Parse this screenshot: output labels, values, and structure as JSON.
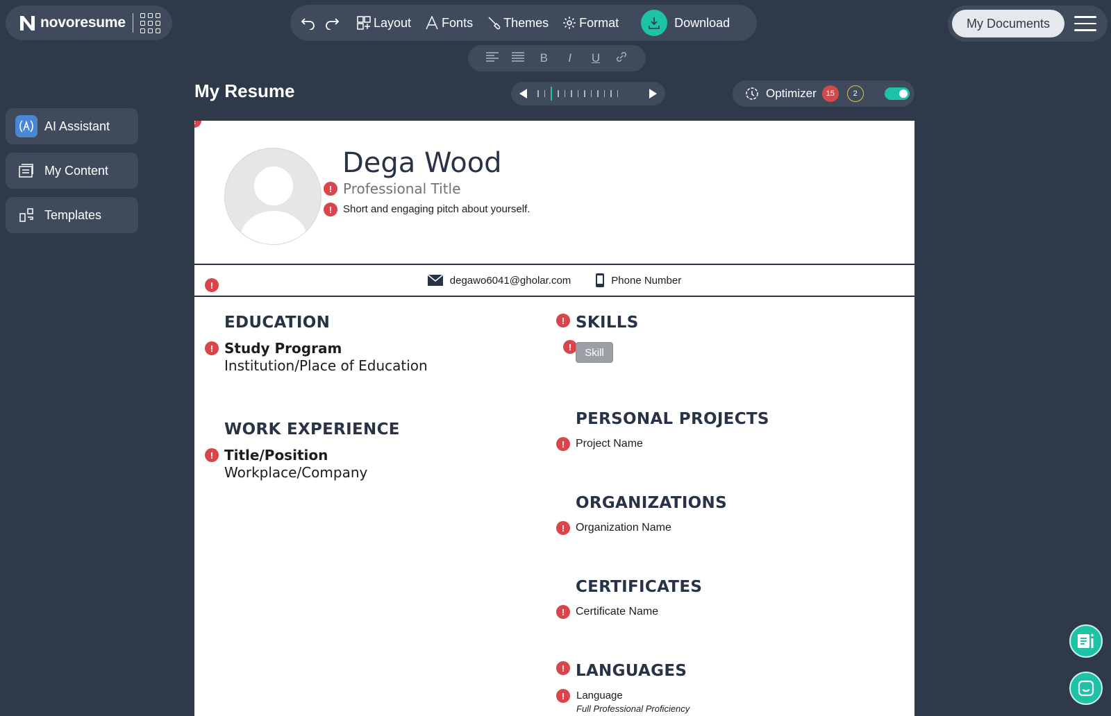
{
  "brand": {
    "name": "novoresume"
  },
  "toolbar": {
    "layout": "Layout",
    "fonts": "Fonts",
    "themes": "Themes",
    "format": "Format",
    "download": "Download"
  },
  "header_right": {
    "my_documents": "My Documents"
  },
  "sidebar": {
    "items": [
      {
        "label": "AI Assistant",
        "icon": "ai-assistant-icon"
      },
      {
        "label": "My Content",
        "icon": "my-content-icon"
      },
      {
        "label": "Templates",
        "icon": "templates-icon"
      }
    ]
  },
  "page": {
    "title": "My Resume"
  },
  "optimizer": {
    "label": "Optimizer",
    "errors": "15",
    "warnings": "2",
    "enabled": true
  },
  "resume": {
    "name": "Dega Wood",
    "professional_title": "Professional Title",
    "pitch": "Short and engaging pitch about yourself.",
    "contact": {
      "email": "degawo6041@gholar.com",
      "phone": "Phone Number"
    },
    "education": {
      "heading": "EDUCATION",
      "program": "Study Program",
      "institution": "Institution/Place of Education"
    },
    "work": {
      "heading": "WORK EXPERIENCE",
      "position": "Title/Position",
      "company": "Workplace/Company"
    },
    "skills": {
      "heading": "SKILLS",
      "skill": "Skill"
    },
    "projects": {
      "heading": "PERSONAL PROJECTS",
      "name": "Project Name"
    },
    "organizations": {
      "heading": "ORGANIZATIONS",
      "name": "Organization Name"
    },
    "certificates": {
      "heading": "CERTIFICATES",
      "name": "Certificate Name"
    },
    "languages": {
      "heading": "LANGUAGES",
      "language": "Language",
      "level": "Full Professional Proficiency"
    }
  },
  "colors": {
    "accent": "#1ec2a6",
    "background": "#2e3a4a",
    "panel": "#3f4b5c",
    "warning": "#d9454a",
    "heading": "#273447"
  }
}
